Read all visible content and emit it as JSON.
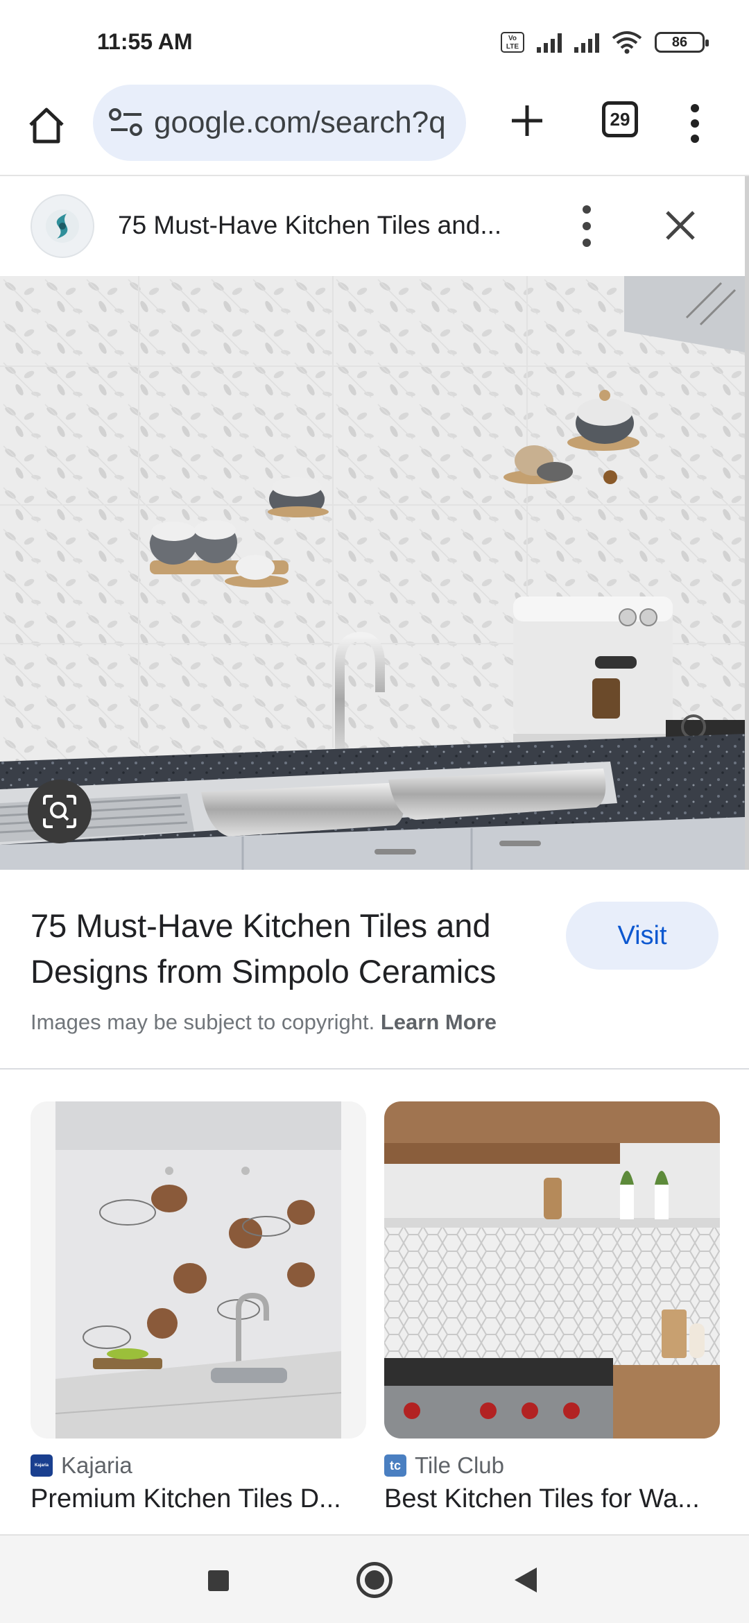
{
  "status_bar": {
    "time": "11:55 AM",
    "volte_label": "Vo LTE",
    "battery": "86"
  },
  "toolbar": {
    "url": "google.com/search?q",
    "tab_count": "29",
    "icons": [
      "home-icon",
      "site-settings-icon",
      "new-tab-icon",
      "tab-switcher-icon",
      "more-vert-icon"
    ]
  },
  "panel": {
    "title": "75 Must-Have Kitchen Tiles and...",
    "icons": [
      "site-logo",
      "more-vert-icon",
      "close-icon"
    ]
  },
  "main_image": {
    "icons": [
      "google-lens-icon"
    ]
  },
  "result": {
    "title": "75 Must-Have Kitchen Tiles and Designs from Simpolo Ceramics",
    "visit_label": "Visit",
    "copyright_text": "Images may be subject to copyright.",
    "learn_more": "Learn More"
  },
  "related": [
    {
      "source": "Kajaria",
      "favicon_text": "Kajaria",
      "favicon_color": "#1a3f8f",
      "title": "Premium Kitchen Tiles D..."
    },
    {
      "source": "Tile Club",
      "favicon_text": "tc",
      "favicon_color": "#4a7fc1",
      "title": "Best Kitchen Tiles for Wa..."
    }
  ],
  "nav_bar": {
    "icons": [
      "recents-icon",
      "home-icon",
      "back-icon"
    ]
  },
  "colors": {
    "accent_blue": "#0b57d0",
    "pill_bg": "#e8eefa"
  }
}
